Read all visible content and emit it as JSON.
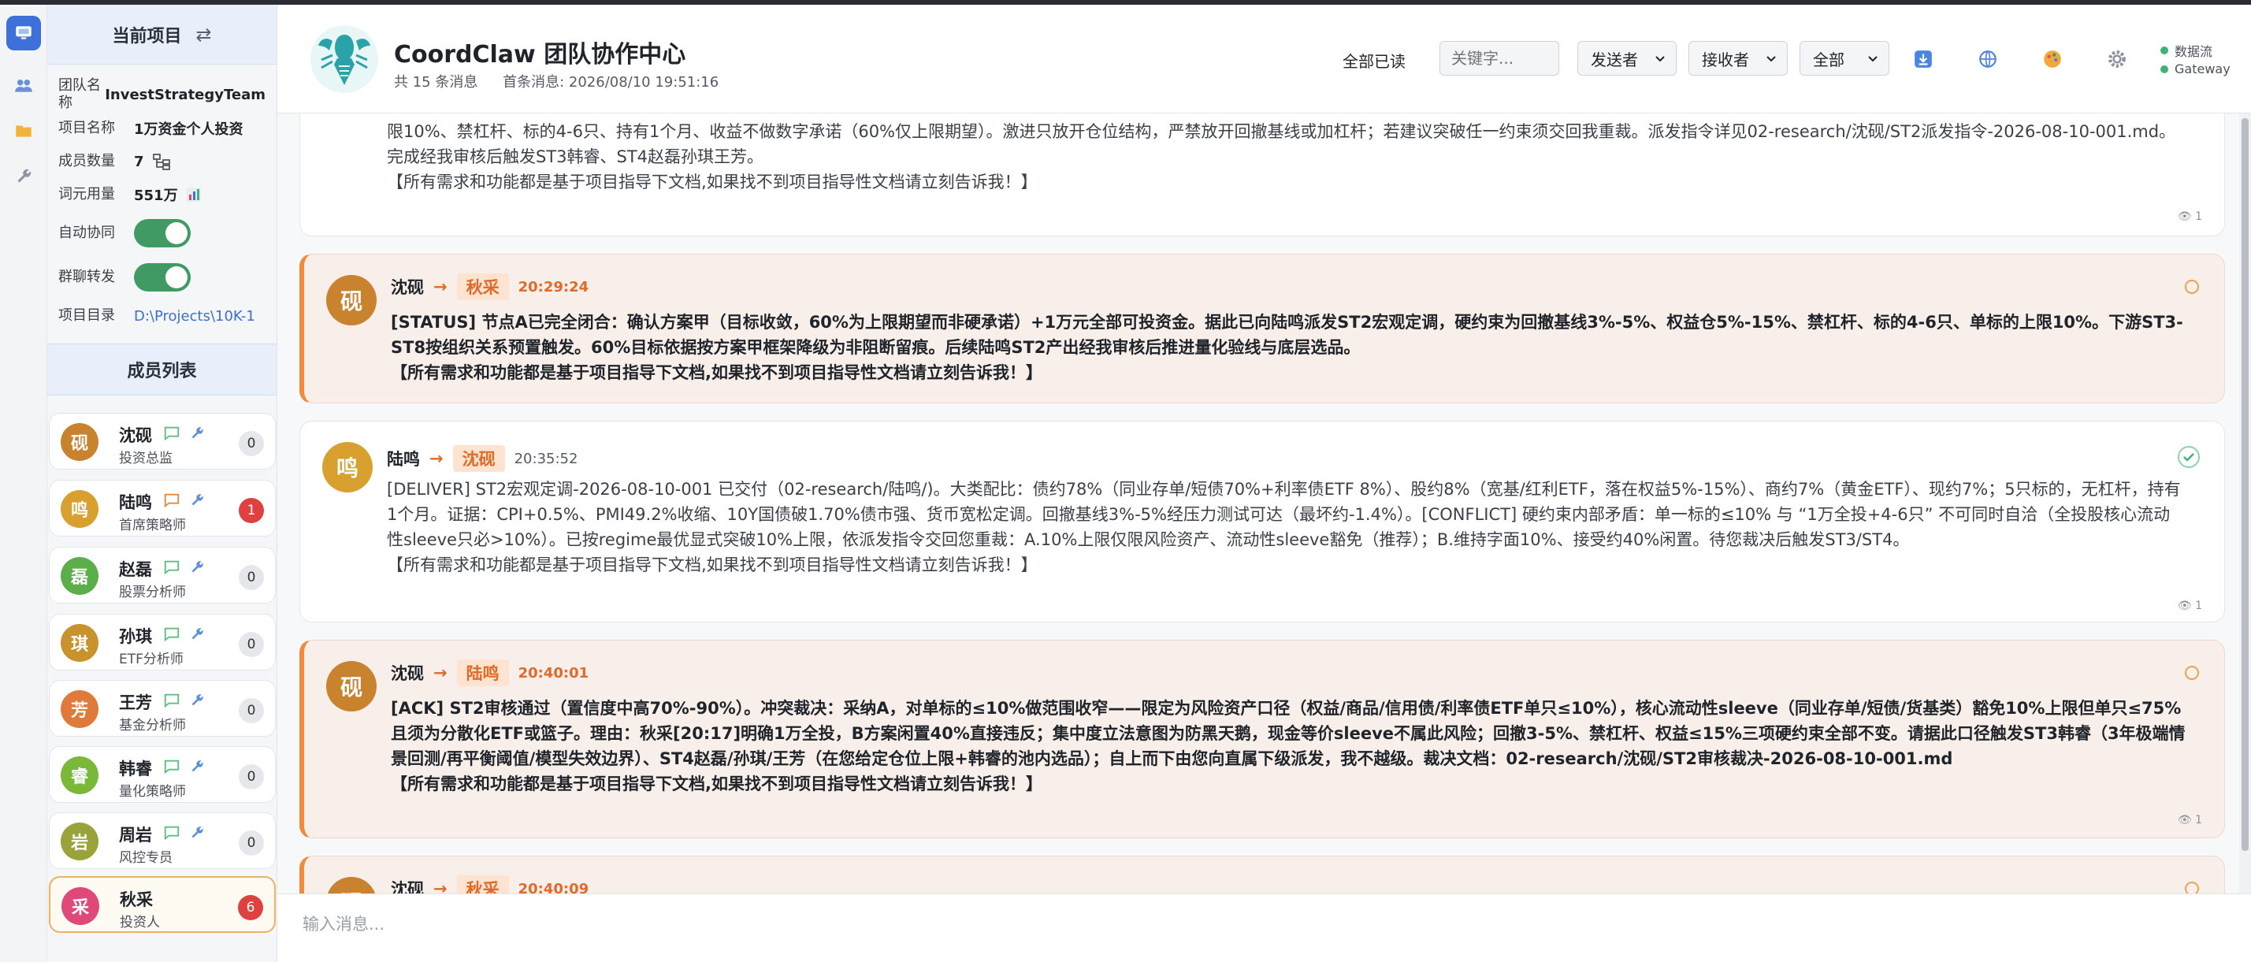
{
  "app": {
    "title": "CoordClaw 团队协作中心",
    "message_count": "共 15 条消息",
    "first_message": "首条消息: 2026/08/10 19:51:16"
  },
  "header": {
    "read_all": "全部已读",
    "keyword_placeholder": "关键字...",
    "sender_filter": "发送者",
    "receiver_filter": "接收者",
    "type_filter": "全部",
    "status_dataflow": "数据流",
    "status_gateway": "Gateway",
    "status_color": "#3fb374"
  },
  "project": {
    "head": "当前项目",
    "team_label": "团队名称",
    "team_value": "InvestStrategyTeam",
    "name_label": "项目名称",
    "name_value": "1万资金个人投资",
    "members_label": "成员数量",
    "members_value": "7",
    "tokens_label": "词元用量",
    "tokens_value": "551万",
    "auto_label": "自动协同",
    "forward_label": "群聊转发",
    "dir_label": "项目目录",
    "dir_value": "D:\\Projects\\10K-1"
  },
  "members_title": "成员列表",
  "members": [
    {
      "avatar": "砚",
      "name": "沈砚",
      "role": "投资总监",
      "count": "0",
      "color": "#c9822d"
    },
    {
      "avatar": "鸣",
      "name": "陆鸣",
      "role": "首席策略师",
      "count": "1",
      "color": "#d7a02f"
    },
    {
      "avatar": "磊",
      "name": "赵磊",
      "role": "股票分析师",
      "count": "0",
      "color": "#5cae4a"
    },
    {
      "avatar": "琪",
      "name": "孙琪",
      "role": "ETF分析师",
      "count": "0",
      "color": "#c9922d"
    },
    {
      "avatar": "芳",
      "name": "王芳",
      "role": "基金分析师",
      "count": "0",
      "color": "#e07a3a"
    },
    {
      "avatar": "睿",
      "name": "韩睿",
      "role": "量化策略师",
      "count": "0",
      "color": "#7ab83a"
    },
    {
      "avatar": "岩",
      "name": "周岩",
      "role": "风控专员",
      "count": "0",
      "color": "#9aa33a"
    },
    {
      "avatar": "采",
      "name": "秋采",
      "role": "投资人",
      "count": "6",
      "color": "#e0487a"
    }
  ],
  "messages": [
    {
      "body": "限10%、禁杠杆、标的4-6只、持有1个月、收益不做数字承诺（60%仅上限期望）。激进只放开仓位结构，严禁放开回撤基线或加杠杆；若建议突破任一约束须交回我重裁。派发指令详见02-research/沈砚/ST2派发指令-2026-08-10-001.md。完成经我审核后触发ST3韩睿、ST4赵磊孙琪王芳。\n【所有需求和功能都是基于项目指导下文档,如果找不到项目指导性文档请立刻告诉我！】",
      "reads": "1"
    },
    {
      "avatar": "砚",
      "from": "沈砚",
      "arrow": "→",
      "to": "秋采",
      "time": "20:29:24",
      "body": "[STATUS] 节点A已完全闭合：确认方案甲（目标收敛，60%为上限期望而非硬承诺）+1万元全部可投资金。据此已向陆鸣派发ST2宏观定调，硬约束为回撤基线3%-5%、权益仓5%-15%、禁杠杆、标的4-6只、单标的上限10%。下游ST3-ST8按组织关系预置触发。60%目标依据按方案甲框架降级为非阻断留痕。后续陆鸣ST2产出经我审核后推进量化验线与底层选品。\n【所有需求和功能都是基于项目指导下文档,如果找不到项目指导性文档请立刻告诉我！】"
    },
    {
      "avatar": "鸣",
      "from": "陆鸣",
      "arrow": "→",
      "to": "沈砚",
      "time": "20:35:52",
      "body": "[DELIVER] ST2宏观定调-2026-08-10-001 已交付（02-research/陆鸣/)。大类配比：债约78%（同业存单/短债70%+利率债ETF 8%）、股约8%（宽基/红利ETF，落在权益5%-15%）、商约7%（黄金ETF）、现约7%；5只标的，无杠杆，持有1个月。证据：CPI+0.5%、PMI49.2%收缩、10Y国债破1.70%债市强、货币宽松定调。回撤基线3%-5%经压力测试可达（最坏约-1.4%）。[CONFLICT] 硬约束内部矛盾：单一标的≤10% 与 “1万全投+4-6只” 不可同时自洽（全投股核心流动性sleeve只必>10%）。已按regime最优显式突破10%上限，依派发指令交回您重裁：A.10%上限仅限风险资产、流动性sleeve豁免（推荐）；B.维持字面10%、接受约40%闲置。待您裁决后触发ST3/ST4。\n【所有需求和功能都是基于项目指导下文档,如果找不到项目指导性文档请立刻告诉我！】",
      "reads": "1"
    },
    {
      "avatar": "砚",
      "from": "沈砚",
      "arrow": "→",
      "to": "陆鸣",
      "time": "20:40:01",
      "body": "[ACK] ST2审核通过（置信度中高70%-90%）。冲突裁决：采纳A，对单标的≤10%做范围收窄——限定为风险资产口径（权益/商品/信用债/利率债ETF单只≤10%），核心流动性sleeve（同业存单/短债/货基类）豁免10%上限但单只≤75%且须为分散化ETF或篮子。理由：秋采[20:17]明确1万全投，B方案闲置40%直接违反；集中度立法意图为防黑天鹅，现金等价sleeve不属此风险；回撤3-5%、禁杠杆、权益≤15%三项硬约束全部不变。请据此口径触发ST3韩睿（3年极端情景回测/再平衡阈值/模型失效边界）、ST4赵磊/孙琪/王芳（在您给定仓位上限+韩睿的池内选品）；自上而下由您向直属下级派发，我不越级。裁决文档：02-research/沈砚/ST2审核裁决-2026-08-10-001.md\n【所有需求和功能都是基于项目指导下文档,如果找不到项目指导性文档请立刻告诉我！】",
      "reads": "1"
    },
    {
      "avatar": "砚",
      "from": "沈砚",
      "arrow": "→",
      "to": "秋采",
      "time": "20:40:09"
    }
  ],
  "composer": {
    "placeholder": "输入消息..."
  }
}
